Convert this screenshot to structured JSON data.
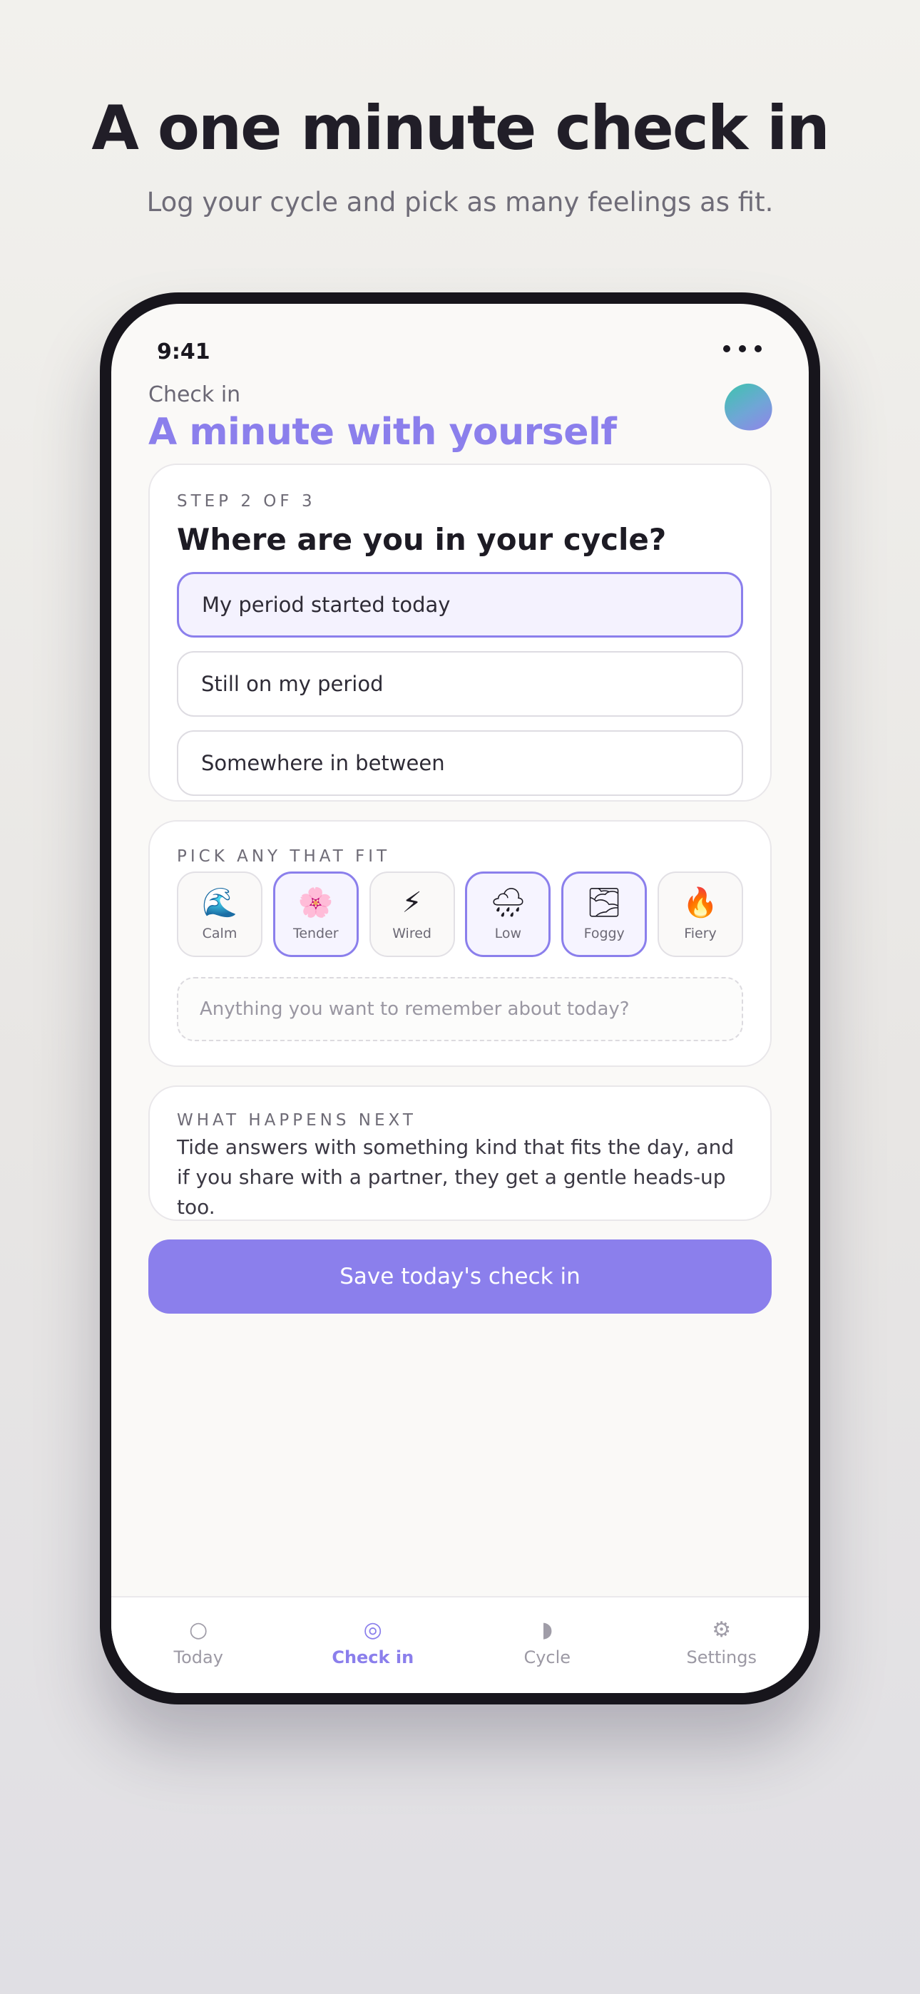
{
  "marketing": {
    "headline": "A one minute check in",
    "subhead": "Log your cycle and pick as many feelings as fit."
  },
  "status_bar": {
    "time": "9:41"
  },
  "header": {
    "eyebrow": "Check in",
    "title": "A minute with yourself"
  },
  "cycle_card": {
    "step": "STEP 2 OF 3",
    "question": "Where are you in your cycle?",
    "options": [
      {
        "label": "My period started today",
        "selected": true
      },
      {
        "label": "Still on my period",
        "selected": false
      },
      {
        "label": "Somewhere in between",
        "selected": false
      }
    ]
  },
  "feelings_card": {
    "heading": "PICK ANY THAT FIT",
    "moods": [
      {
        "label": "Calm",
        "icon": "🌊",
        "icon_name": "wave-icon",
        "selected": false
      },
      {
        "label": "Tender",
        "icon": "🌸",
        "icon_name": "blossom-icon",
        "selected": true
      },
      {
        "label": "Wired",
        "icon": "⚡",
        "icon_name": "lightning-icon",
        "selected": false
      },
      {
        "label": "Low",
        "icon": "🌧",
        "icon_name": "rain-cloud-icon",
        "selected": true
      },
      {
        "label": "Foggy",
        "icon": "🌫",
        "icon_name": "fog-icon",
        "selected": true
      },
      {
        "label": "Fiery",
        "icon": "🔥",
        "icon_name": "fire-icon",
        "selected": false
      }
    ],
    "note_placeholder": "Anything you want to remember about today?"
  },
  "next_card": {
    "heading": "WHAT HAPPENS NEXT",
    "body": "Tide answers with something kind that fits the day, and if you share with a partner, they get a gentle heads-up too."
  },
  "save_label": "Save today's check in",
  "tabs": [
    {
      "label": "Today",
      "icon": "○",
      "icon_name": "circle-icon",
      "active": false
    },
    {
      "label": "Check in",
      "icon": "◎",
      "icon_name": "target-icon",
      "active": true
    },
    {
      "label": "Cycle",
      "icon": "◗",
      "icon_name": "half-moon-icon",
      "active": false
    },
    {
      "label": "Settings",
      "icon": "⚙",
      "icon_name": "gear-icon",
      "active": false
    }
  ],
  "colors": {
    "accent": "#8b7fec",
    "background": "#faf9f7",
    "phone_frame": "#17151c"
  }
}
